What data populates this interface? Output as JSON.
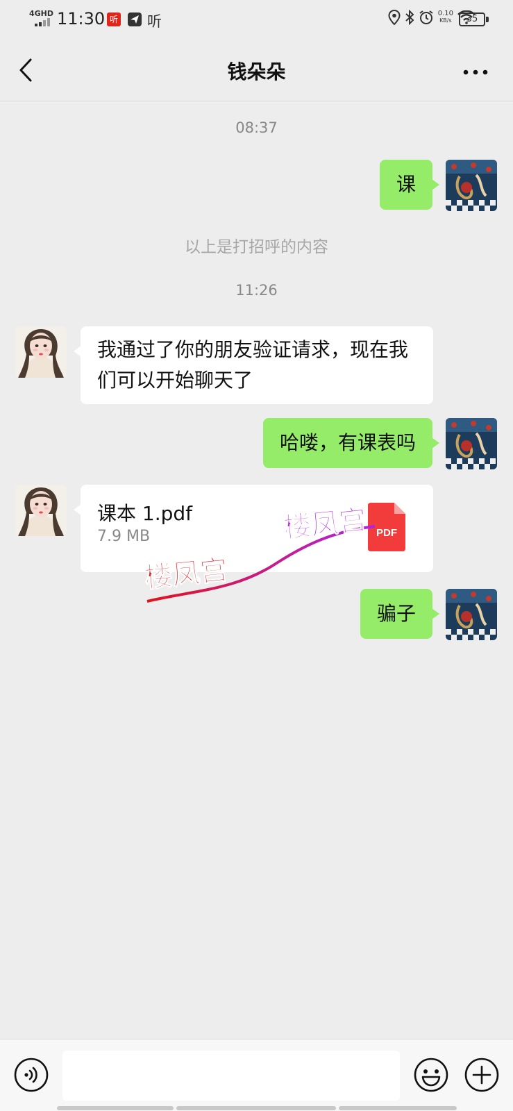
{
  "status_bar": {
    "network": "4GHD",
    "time": "11:30",
    "app_badge": "听",
    "app_text": "听",
    "speed_value": "0.10",
    "speed_unit": "KB/s",
    "battery": "35"
  },
  "header": {
    "title": "钱朵朵",
    "back_icon": "chevron-left-icon",
    "more_icon": "more-dots-icon"
  },
  "chat": {
    "timestamp_1": "08:37",
    "msg_1": "课",
    "system_notice": "以上是打招呼的内容",
    "timestamp_2": "11:26",
    "msg_2": "我通过了你的朋友验证请求，现在我们可以开始聊天了",
    "msg_3": "哈喽，有课表吗",
    "file": {
      "name": "课本 1.pdf",
      "size": "7.9 MB",
      "type_label": "PDF"
    },
    "msg_4": "骗子"
  },
  "watermark": {
    "text_1": "楼凤宫",
    "text_2": "楼凤宫"
  },
  "input": {
    "value": "",
    "placeholder": ""
  },
  "colors": {
    "bubble_mine": "#95ec69",
    "bubble_theirs": "#ffffff",
    "background": "#ededed",
    "pdf_red": "#f23b3b"
  }
}
